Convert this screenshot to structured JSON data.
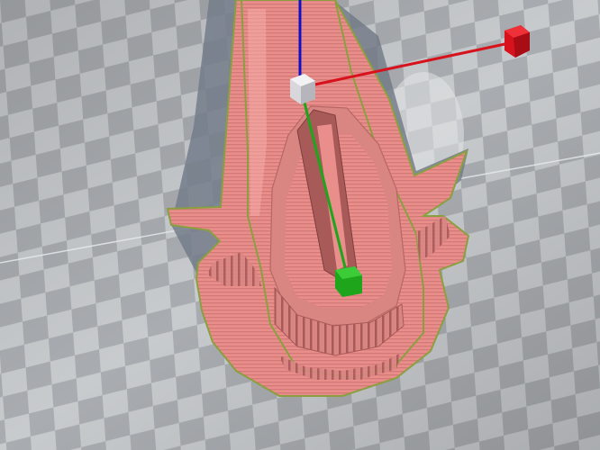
{
  "viewport": {
    "view": "3D viewport",
    "background": "checkerboard",
    "colors": {
      "checker_light": "#c8cbce",
      "checker_dark": "#a9acb0",
      "model_fill": "#e98e8b",
      "model_shadow": "#c46b69",
      "model_highlight": "#f4aba7",
      "outline": "#8aa040",
      "shadow_volume": "#747d8b",
      "gizmo_x": "#d8121c",
      "gizmo_y": "#1ea51c",
      "gizmo_z": "#1010c8",
      "gizmo_center": "#d8d8dc"
    }
  },
  "model": {
    "name": "sliced-model",
    "icon": "3d-mesh-icon"
  },
  "gizmo": {
    "axes": [
      "x",
      "y",
      "z"
    ],
    "handles": [
      "x-axis-handle",
      "y-axis-handle",
      "center-handle"
    ]
  }
}
